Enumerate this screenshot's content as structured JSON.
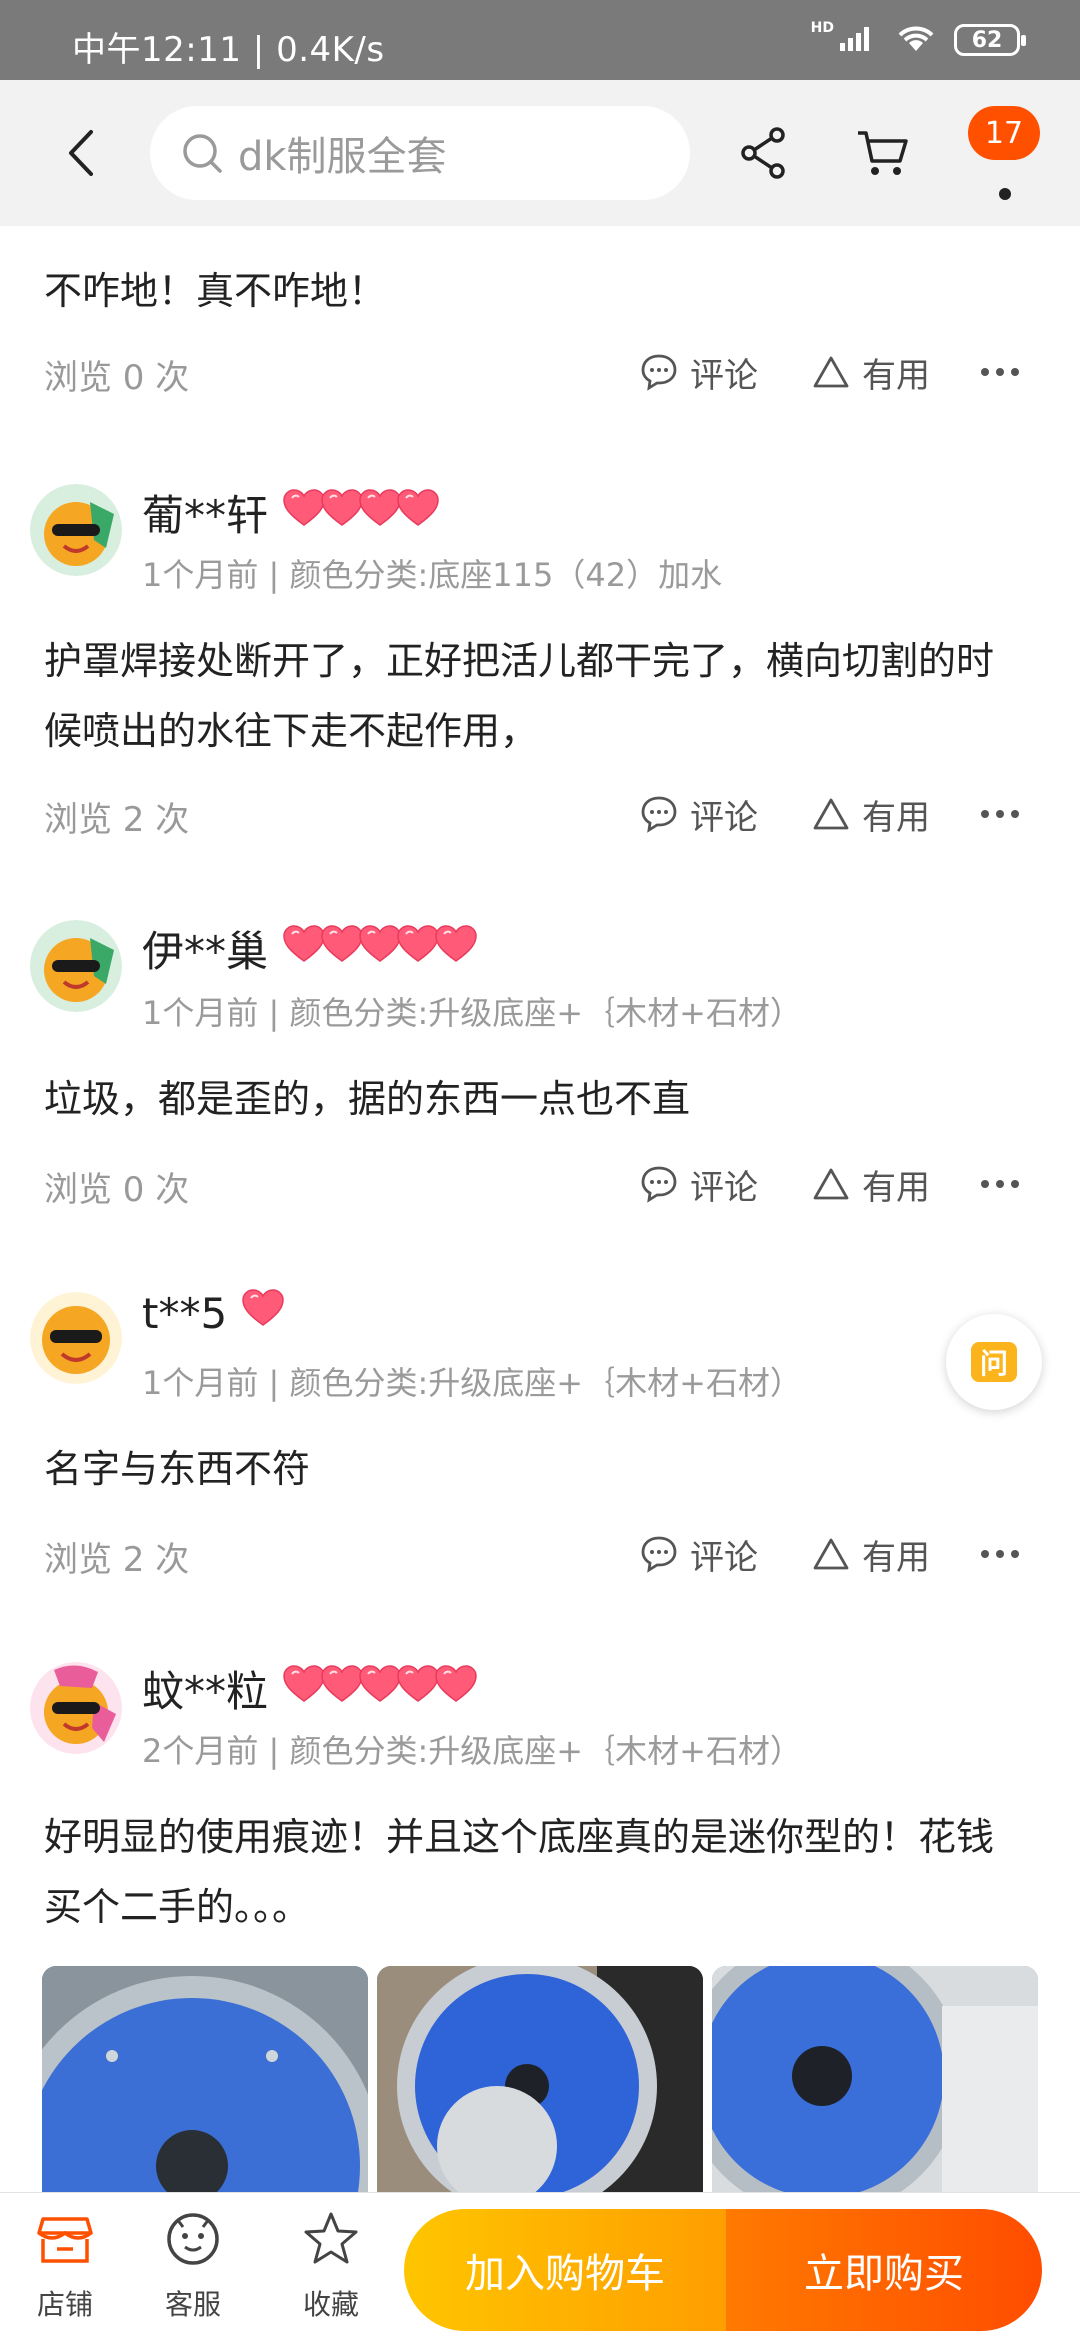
{
  "status_bar": {
    "time": "中午12:11",
    "speed": "0.4K/s",
    "hd": "HD",
    "battery": "62"
  },
  "header": {
    "search_placeholder": "dk制服全套",
    "badge_count": "17"
  },
  "top_review": {
    "text": "不咋地！真不咋地！",
    "views": "浏览 0 次"
  },
  "actions": {
    "comment": "评论",
    "useful": "有用"
  },
  "reviews": [
    {
      "username": "葡**轩",
      "hearts": 4,
      "meta": "1个月前 | 颜色分类:底座115（42）加水",
      "text_lines": [
        "护罩焊接处断开了，正好把活儿都干完了，横向切割的时",
        "候喷出的水往下走不起作用，"
      ],
      "views": "浏览 2 次"
    },
    {
      "username": "伊**巢",
      "hearts": 5,
      "meta": "1个月前 | 颜色分类:升级底座+｛木材+石材）",
      "text_lines": [
        "垃圾，都是歪的，据的东西一点也不直"
      ],
      "views": "浏览 0 次"
    },
    {
      "username": "t**5",
      "hearts": 1,
      "meta": "1个月前 | 颜色分类:升级底座+｛木材+石材）",
      "text_lines": [
        "名字与东西不符"
      ],
      "views": "浏览 2 次"
    },
    {
      "username": "蚊**粒",
      "hearts": 5,
      "meta": "2个月前 | 颜色分类:升级底座+｛木材+石材）",
      "text_lines": [
        "好明显的使用痕迹！并且这个底座真的是迷你型的！花钱",
        "买个二手的。。。"
      ],
      "views": ""
    }
  ],
  "ask_button": "问",
  "bottom_bar": {
    "store": "店铺",
    "service": "客服",
    "favorite": "收藏",
    "add_to_cart": "加入购物车",
    "buy_now": "立即购买"
  },
  "colors": {
    "accent": "#ff5000",
    "cart_btn": "#ffb000",
    "buy_btn": "#ff5a00",
    "heart": "#ff5b78"
  }
}
